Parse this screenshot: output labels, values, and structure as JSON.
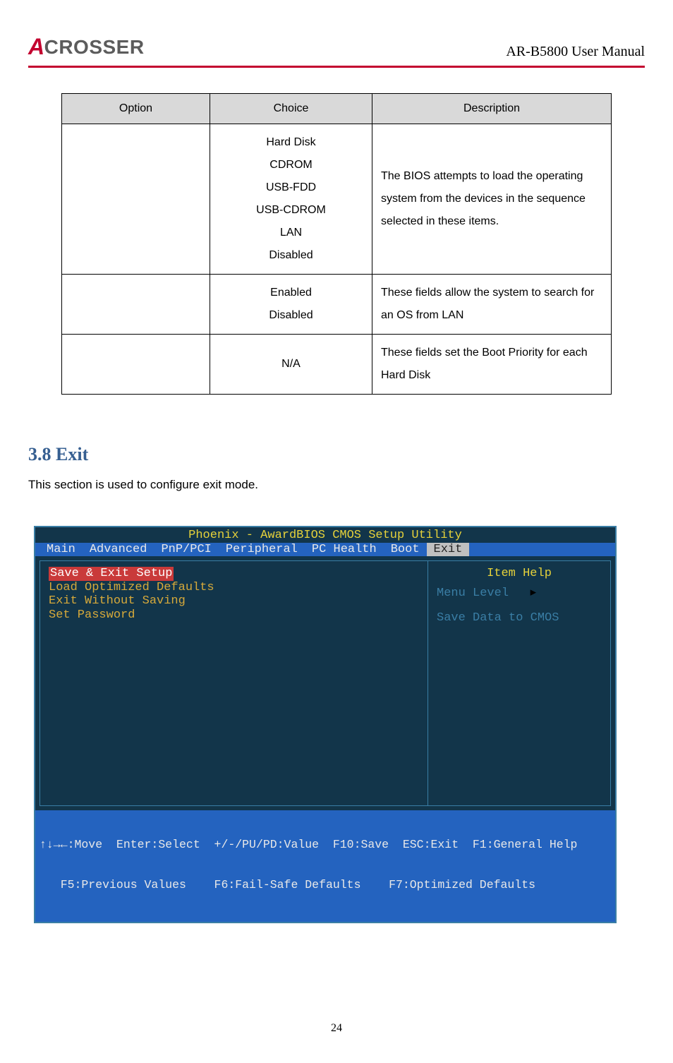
{
  "header": {
    "logo_letter": "A",
    "logo_rest": "CROSSER",
    "doc_title": "AR-B5800 User Manual"
  },
  "table": {
    "headers": {
      "option": "Option",
      "choice": "Choice",
      "description": "Description"
    },
    "rows": [
      {
        "option": "",
        "choices": [
          "Hard Disk",
          "CDROM",
          "USB-FDD",
          "USB-CDROM",
          "LAN",
          "Disabled"
        ],
        "description": "The BIOS attempts to load the operating system from the devices in the sequence selected in these items."
      },
      {
        "option": "",
        "choices": [
          "Enabled",
          "Disabled"
        ],
        "description": "These fields allow the system to search for an OS from LAN"
      },
      {
        "option": "",
        "choices": [
          "N/A"
        ],
        "description": "These fields set the Boot Priority for each Hard Disk"
      }
    ]
  },
  "section": {
    "heading": "3.8 Exit",
    "body": "This section is used to configure exit mode."
  },
  "bios": {
    "title": "Phoenix - AwardBIOS CMOS Setup Utility",
    "tabs": [
      "Main",
      "Advanced",
      "PnP/PCI",
      "Peripheral",
      "PC Health",
      "Boot",
      "Exit"
    ],
    "active_tab": "Exit",
    "menu": [
      {
        "label": "Save & Exit Setup",
        "selected": true
      },
      {
        "label": "Load Optimized Defaults",
        "selected": false
      },
      {
        "label": "Exit Without Saving",
        "selected": false
      },
      {
        "label": "Set Password",
        "selected": false
      }
    ],
    "help": {
      "title": "Item Help",
      "menu_level_label": "Menu Level",
      "menu_level_arrow": "▸",
      "text": "Save Data to CMOS"
    },
    "footer_line1": "↑↓→←:Move  Enter:Select  +/-/PU/PD:Value  F10:Save  ESC:Exit  F1:General Help",
    "footer_line2": "   F5:Previous Values    F6:Fail-Safe Defaults    F7:Optimized Defaults"
  },
  "page_number": "24"
}
